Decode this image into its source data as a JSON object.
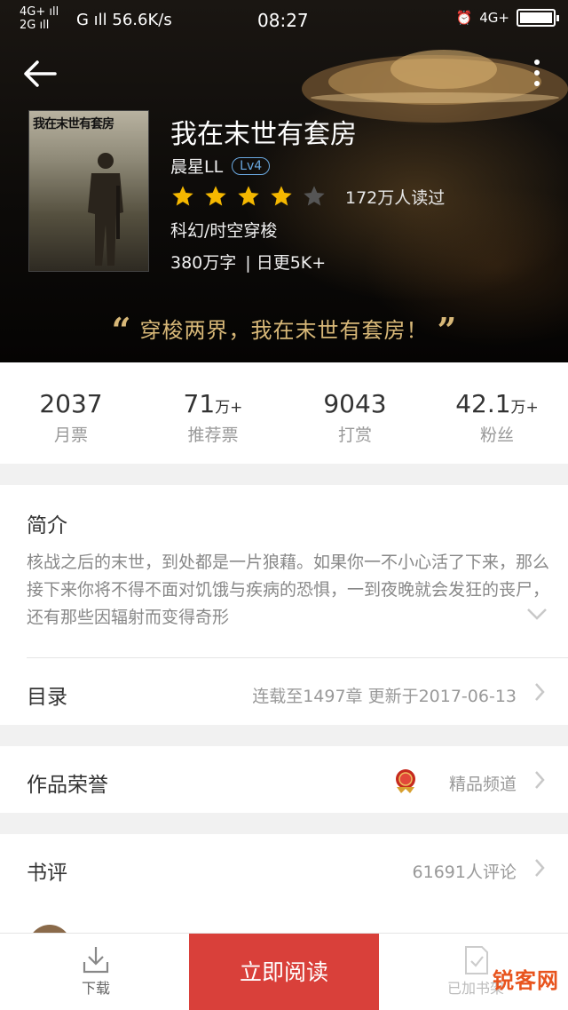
{
  "status_bar": {
    "signal_top": "4G+",
    "signal_bottom": "2G",
    "network": "G",
    "speed": "56.6K/s",
    "time": "08:27",
    "right_network": "4G+"
  },
  "book": {
    "cover_title": "我在末世有套房",
    "title": "我在末世有套房",
    "author": "晨星LL",
    "level": "Lv4",
    "rating_stars": 4,
    "rating_max": 5,
    "readers": "172万人读过",
    "genre": "科幻/时空穿梭",
    "word_count": "380万字",
    "update_rate": "| 日更5K+",
    "slogan": "穿梭两界，我在末世有套房！"
  },
  "stats": [
    {
      "num": "2037",
      "unit": "",
      "label": "月票"
    },
    {
      "num": "71",
      "unit": "万+",
      "label": "推荐票"
    },
    {
      "num": "9043",
      "unit": "",
      "label": "打赏"
    },
    {
      "num": "42.1",
      "unit": "万+",
      "label": "粉丝"
    }
  ],
  "intro": {
    "title": "简介",
    "text": "核战之后的末世，到处都是一片狼藉。如果你一不小心活了下来，那么接下来你将不得不面对饥饿与疾病的恐惧，一到夜晚就会发狂的丧尸，还有那些因辐射而变得奇形"
  },
  "toc": {
    "label": "目录",
    "value": "连载至1497章  更新于2017-06-13"
  },
  "honor": {
    "label": "作品荣誉",
    "value": "精品频道"
  },
  "review": {
    "label": "书评",
    "value": "61691人评论"
  },
  "bottom_bar": {
    "download_label": "下载",
    "read_label": "立即阅读",
    "shelf_label": "已加书架"
  },
  "watermark": "锐客网",
  "colors": {
    "accent_red": "#d9403a",
    "star_gold": "#f5b800",
    "slogan_gold": "#d8b878",
    "level_blue": "#6aa8e0"
  }
}
